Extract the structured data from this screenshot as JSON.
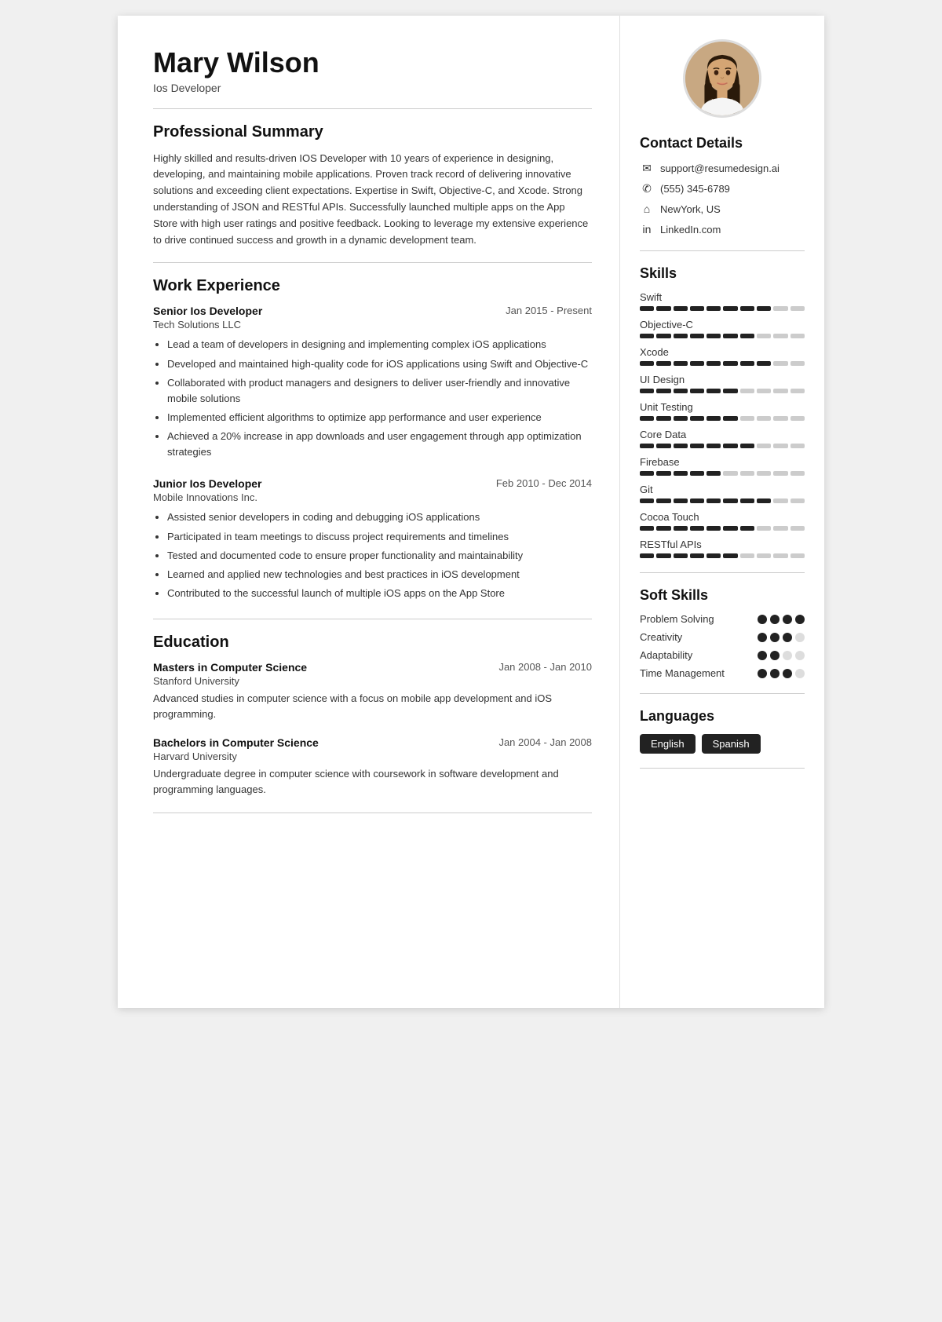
{
  "header": {
    "name": "Mary Wilson",
    "title": "Ios Developer"
  },
  "summary": {
    "section_title": "Professional Summary",
    "text": "Highly skilled and results-driven IOS Developer with 10 years of experience in designing, developing, and maintaining mobile applications. Proven track record of delivering innovative solutions and exceeding client expectations. Expertise in Swift, Objective-C, and Xcode. Strong understanding of JSON and RESTful APIs. Successfully launched multiple apps on the App Store with high user ratings and positive feedback. Looking to leverage my extensive experience to drive continued success and growth in a dynamic development team."
  },
  "work_experience": {
    "section_title": "Work Experience",
    "jobs": [
      {
        "title": "Senior Ios Developer",
        "company": "Tech Solutions LLC",
        "dates": "Jan 2015 - Present",
        "bullets": [
          "Lead a team of developers in designing and implementing complex iOS applications",
          "Developed and maintained high-quality code for iOS applications using Swift and Objective-C",
          "Collaborated with product managers and designers to deliver user-friendly and innovative mobile solutions",
          "Implemented efficient algorithms to optimize app performance and user experience",
          "Achieved a 20% increase in app downloads and user engagement through app optimization strategies"
        ]
      },
      {
        "title": "Junior Ios Developer",
        "company": "Mobile Innovations Inc.",
        "dates": "Feb 2010 - Dec 2014",
        "bullets": [
          "Assisted senior developers in coding and debugging iOS applications",
          "Participated in team meetings to discuss project requirements and timelines",
          "Tested and documented code to ensure proper functionality and maintainability",
          "Learned and applied new technologies and best practices in iOS development",
          "Contributed to the successful launch of multiple iOS apps on the App Store"
        ]
      }
    ]
  },
  "education": {
    "section_title": "Education",
    "items": [
      {
        "degree": "Masters in Computer Science",
        "school": "Stanford University",
        "dates": "Jan 2008 - Jan 2010",
        "description": "Advanced studies in computer science with a focus on mobile app development and iOS programming."
      },
      {
        "degree": "Bachelors in Computer Science",
        "school": "Harvard University",
        "dates": "Jan 2004 - Jan 2008",
        "description": "Undergraduate degree in computer science with coursework in software development and programming languages."
      }
    ]
  },
  "contact": {
    "section_title": "Contact Details",
    "email": "support@resumedesign.ai",
    "phone": "(555) 345-6789",
    "location": "NewYork, US",
    "linkedin": "LinkedIn.com"
  },
  "skills": {
    "section_title": "Skills",
    "items": [
      {
        "name": "Swift",
        "filled": 8,
        "total": 10
      },
      {
        "name": "Objective-C",
        "filled": 7,
        "total": 10
      },
      {
        "name": "Xcode",
        "filled": 8,
        "total": 10
      },
      {
        "name": "UI Design",
        "filled": 6,
        "total": 10
      },
      {
        "name": "Unit Testing",
        "filled": 6,
        "total": 10
      },
      {
        "name": "Core Data",
        "filled": 7,
        "total": 10
      },
      {
        "name": "Firebase",
        "filled": 5,
        "total": 10
      },
      {
        "name": "Git",
        "filled": 8,
        "total": 10
      },
      {
        "name": "Cocoa Touch",
        "filled": 7,
        "total": 10
      },
      {
        "name": "RESTful APIs",
        "filled": 6,
        "total": 10
      }
    ]
  },
  "soft_skills": {
    "section_title": "Soft Skills",
    "items": [
      {
        "name": "Problem Solving",
        "filled": 4,
        "total": 4
      },
      {
        "name": "Creativity",
        "filled": 3,
        "total": 4
      },
      {
        "name": "Adaptability",
        "filled": 2,
        "total": 4
      },
      {
        "name": "Time Management",
        "filled": 3,
        "total": 4
      }
    ]
  },
  "languages": {
    "section_title": "Languages",
    "items": [
      "English",
      "Spanish"
    ]
  }
}
